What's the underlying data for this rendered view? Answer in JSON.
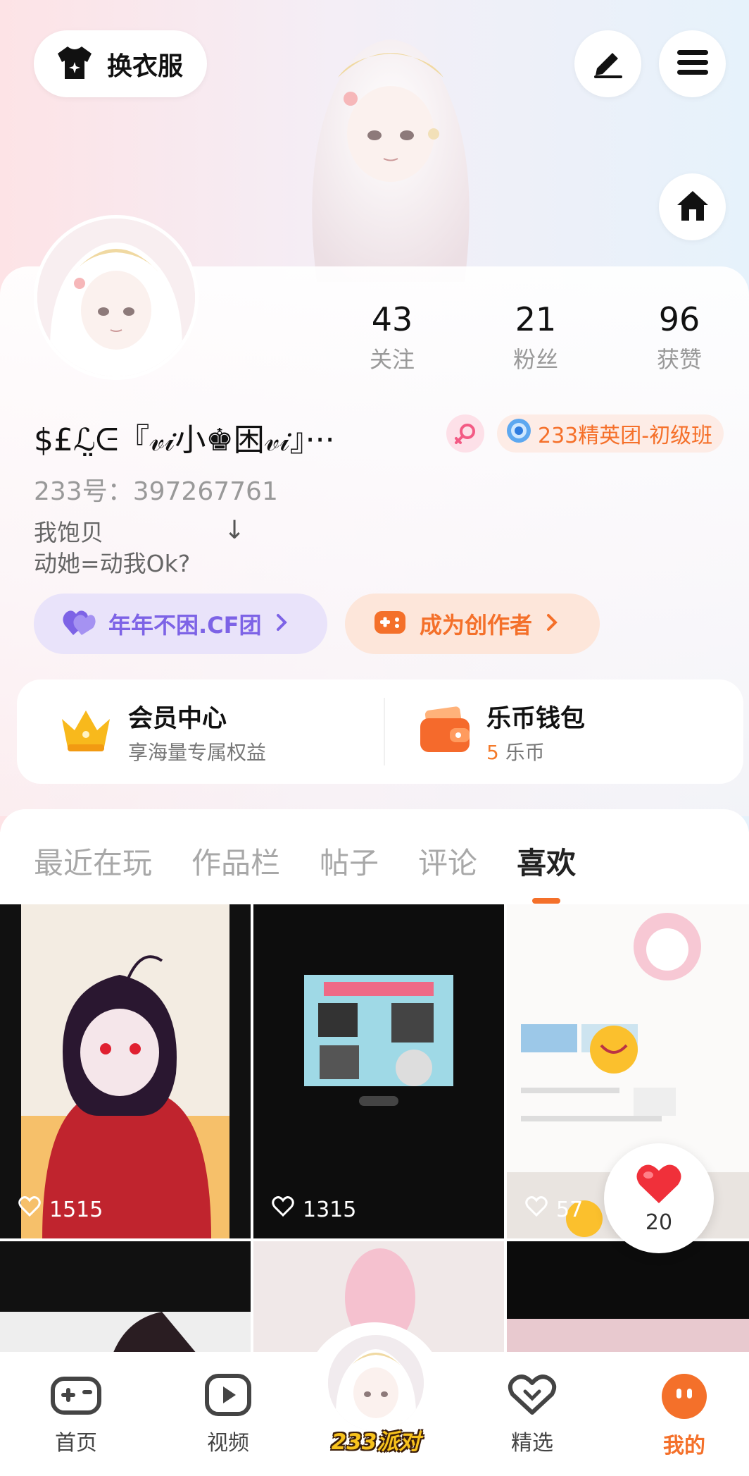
{
  "header": {
    "dress_button_label": "换衣服",
    "edit_icon": "pencil-icon",
    "menu_icon": "hamburger-menu-icon",
    "home_icon": "home-icon"
  },
  "profile": {
    "stats": [
      {
        "value": "43",
        "label": "关注"
      },
      {
        "value": "21",
        "label": "粉丝"
      },
      {
        "value": "96",
        "label": "获赞"
      }
    ],
    "nickname": "$£ℒ̤ᕮ『𝓋𝒾小♚困𝓋𝒾』···",
    "gender": "female",
    "level_badge": "233精英团-初级班",
    "user_id": "233号：397267761",
    "bio_line1": "我饱贝",
    "bio_arrow": "↓",
    "bio_line2": "动她=动我Ok?"
  },
  "pills": {
    "team": "年年不困.CF团",
    "creator": "成为创作者"
  },
  "benefits": {
    "vip_title": "会员中心",
    "vip_sub": "享海量专属权益",
    "wallet_title": "乐币钱包",
    "wallet_amount": "5",
    "wallet_unit": "乐币"
  },
  "tabs": [
    "最近在玩",
    "作品栏",
    "帖子",
    "评论",
    "喜欢"
  ],
  "active_tab": "喜欢",
  "grid": {
    "likes": [
      "1515",
      "1315",
      "57"
    ]
  },
  "floating_like": {
    "count": "20"
  },
  "bottom_nav": {
    "home": "首页",
    "video": "视频",
    "center": "233派对",
    "featured": "精选",
    "mine": "我的"
  },
  "colors": {
    "accent": "#f4702a",
    "team_purple": "#7d63e6",
    "badge_gold": "#f7c21d"
  }
}
